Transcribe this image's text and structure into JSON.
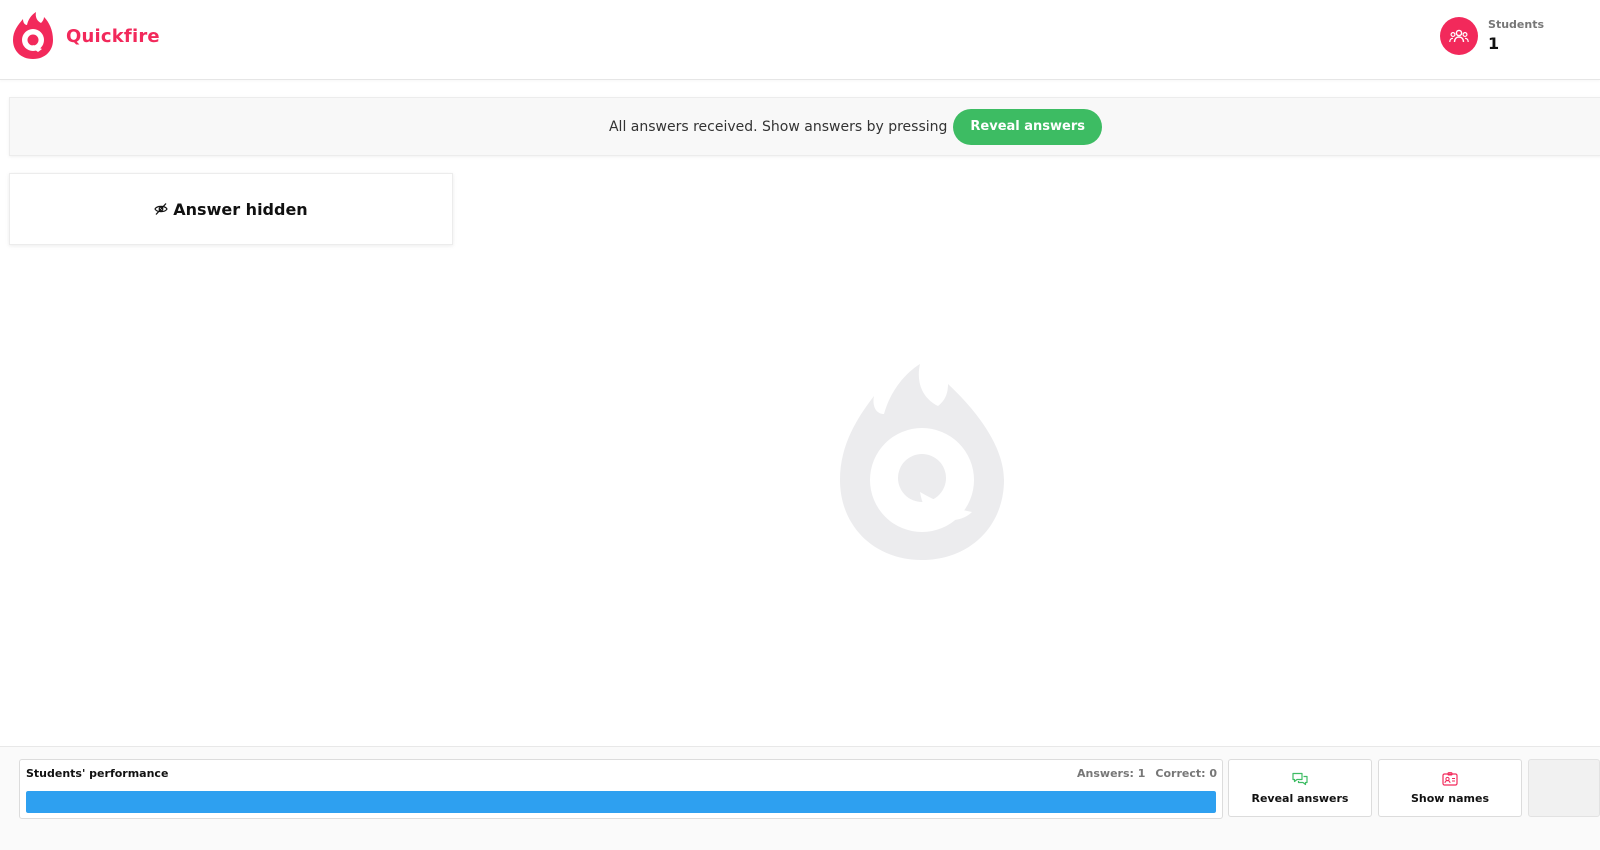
{
  "app": {
    "name": "Quickfire",
    "brand_color": "#f2295b",
    "logo_icon": "quickfire-flame-logo"
  },
  "header": {
    "students_label": "Students",
    "students_count": "1",
    "students_icon": "group-icon"
  },
  "notice": {
    "message": "All answers received. Show answers by pressing",
    "button_label": "Reveal answers",
    "button_color": "#3dbc63"
  },
  "answer_card": {
    "icon": "eye-slash-icon",
    "label": "Answer hidden"
  },
  "performance": {
    "title": "Students' performance",
    "answers_text": "Answers: 1",
    "correct_text": "Correct: 0",
    "progress_fraction": 1.0,
    "bar_color": "#2ea0f0"
  },
  "actions": {
    "reveal": {
      "label": "Reveal answers",
      "icon": "chat-bubbles-icon",
      "icon_color": "#3dbc63"
    },
    "names": {
      "label": "Show names",
      "icon": "id-card-icon",
      "icon_color": "#f2295b"
    }
  }
}
